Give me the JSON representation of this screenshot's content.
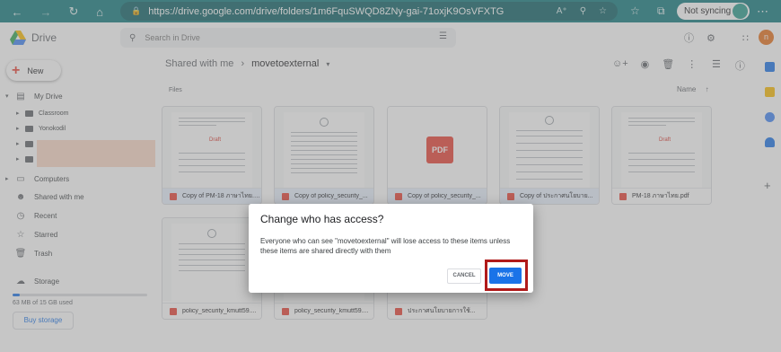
{
  "browser": {
    "url": "https://drive.google.com/drive/folders/1m6FquSWQD8ZNy-gai-71oxjK9OsVFXTG",
    "sync_label": "Not syncing"
  },
  "app": {
    "name": "Drive",
    "search_placeholder": "Search in Drive",
    "user_initial": "n"
  },
  "sidebar": {
    "new_label": "New",
    "my_drive": "My Drive",
    "tree": [
      "Classroom",
      "Yonokodil"
    ],
    "items": [
      "Computers",
      "Shared with me",
      "Recent",
      "Starred",
      "Trash"
    ],
    "storage_label": "Storage",
    "storage_used": "63 MB of 15 GB used",
    "buy_storage": "Buy storage"
  },
  "main": {
    "breadcrumb_root": "Shared with me",
    "breadcrumb_current": "movetoexternal",
    "files_label": "Files",
    "sort_label": "Name",
    "files": [
      {
        "name": "Copy of PM-18 ภาษาไทย.p...",
        "selected": true,
        "thumb": "doc-stamp"
      },
      {
        "name": "Copy of policy_security_...",
        "selected": true,
        "thumb": "doc"
      },
      {
        "name": "Copy of policy_security_...",
        "selected": true,
        "thumb": "pdf"
      },
      {
        "name": "Copy of ประกาศนโยบาย...",
        "selected": true,
        "thumb": "doc"
      },
      {
        "name": "PM-18 ภาษาไทย.pdf",
        "selected": false,
        "thumb": "doc-stamp"
      },
      {
        "name": "policy_security_kmutt59....",
        "selected": false,
        "thumb": "doc"
      },
      {
        "name": "policy_security_kmutt59....",
        "selected": false,
        "thumb": "doc"
      },
      {
        "name": "ประกาศนโยบายการใช้...",
        "selected": false,
        "thumb": "blank"
      }
    ],
    "pdf_thumb_label": "PDF",
    "stamp_label": "Draft"
  },
  "dialog": {
    "title": "Change who has access?",
    "body": "Everyone who can see \"movetoexternal\" will lose access to these items unless these items are shared directly with them",
    "cancel_label": "CANCEL",
    "move_label": "MOVE"
  },
  "colors": {
    "browser_bar": "#117a7e",
    "accent": "#1a73e8",
    "highlight_border": "#b01a1a"
  }
}
